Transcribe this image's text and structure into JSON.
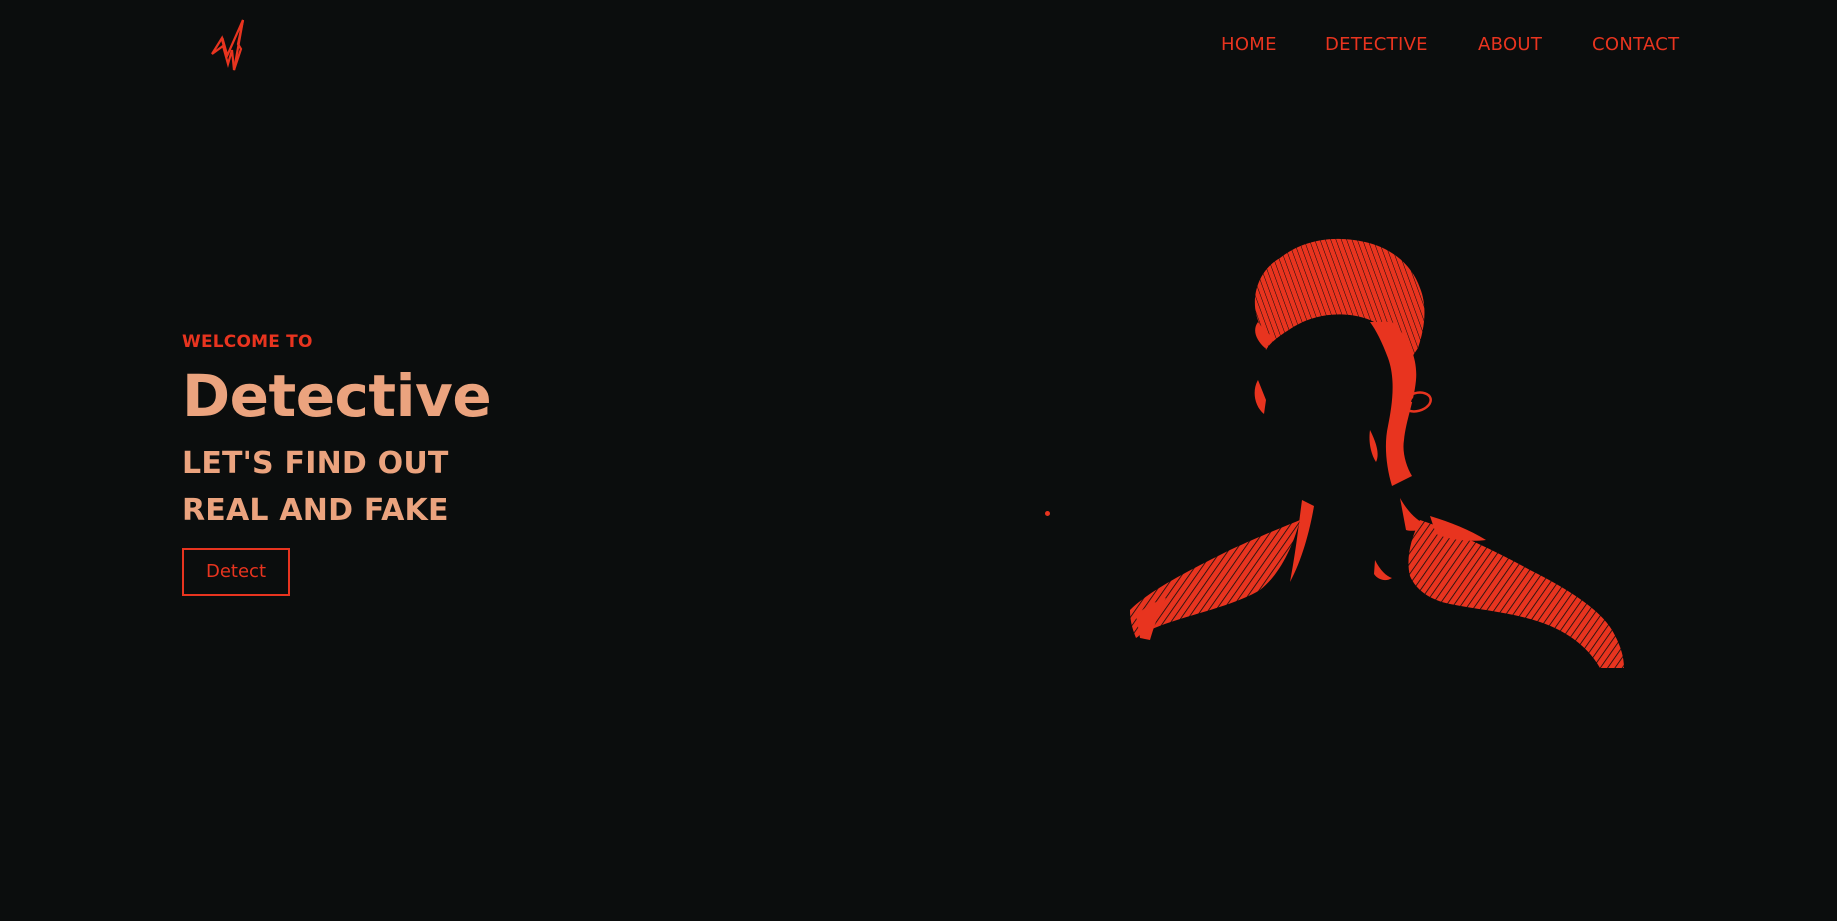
{
  "brand": {
    "logo_icon": "lightning-bolt-icon",
    "accent_color": "#e8341f",
    "headline_color": "#eba37e",
    "background_color": "#0b0d0d"
  },
  "nav": {
    "items": [
      {
        "label": "HOME"
      },
      {
        "label": "DETECTIVE"
      },
      {
        "label": "ABOUT"
      },
      {
        "label": "CONTACT"
      }
    ]
  },
  "hero": {
    "eyebrow": "WELCOME TO",
    "title": "Detective",
    "subtitle_line1": "LET'S FIND OUT",
    "subtitle_line2": "REAL AND FAKE",
    "cta_label": "Detect"
  },
  "artwork": {
    "image": "detective-silhouette-portrait"
  }
}
